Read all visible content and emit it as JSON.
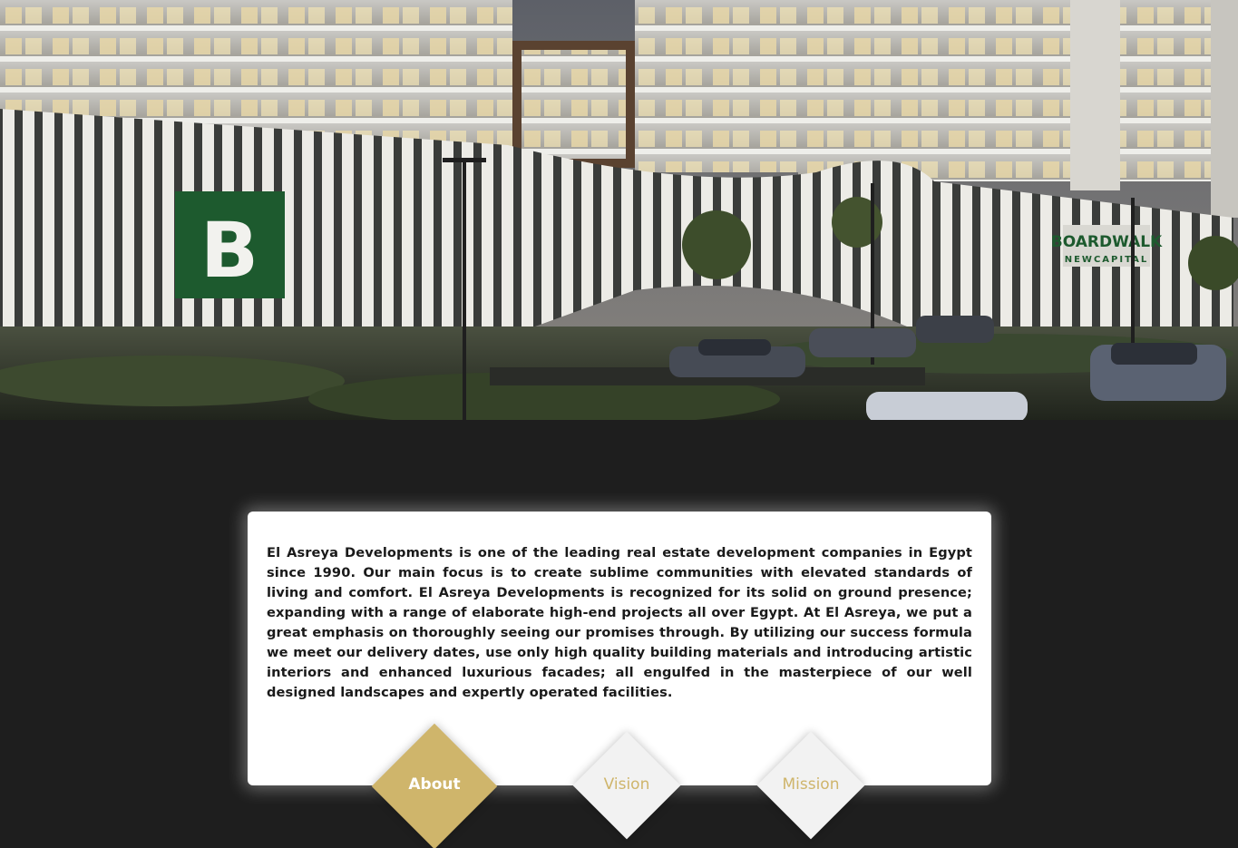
{
  "hero": {
    "logo_letter": "B",
    "sign_text": "BOARDWALK",
    "sign_subtext": "NEWCAPITAL"
  },
  "about": {
    "description": "El Asreya Developments is one of the leading real estate development companies in Egypt since 1990. Our main focus is to create sublime communities with elevated standards of living and comfort. El Asreya Developments is recognized for its solid on ground presence; expanding with a range of elaborate high-end projects all over Egypt. At El Asreya, we put a great emphasis on thoroughly seeing our promises through. By utilizing our success formula we meet our delivery dates, use only high quality building materials and introducing artistic interiors and enhanced luxurious facades; all engulfed in the masterpiece of our well designed landscapes and expertly operated facilities."
  },
  "tabs": [
    {
      "label": "About",
      "active": true
    },
    {
      "label": "Vision",
      "active": false
    },
    {
      "label": "Mission",
      "active": false
    }
  ],
  "colors": {
    "accent_gold": "#cfb56b",
    "background": "#1e1e1e",
    "card": "#ffffff",
    "logo_green": "#1d5a2e"
  }
}
